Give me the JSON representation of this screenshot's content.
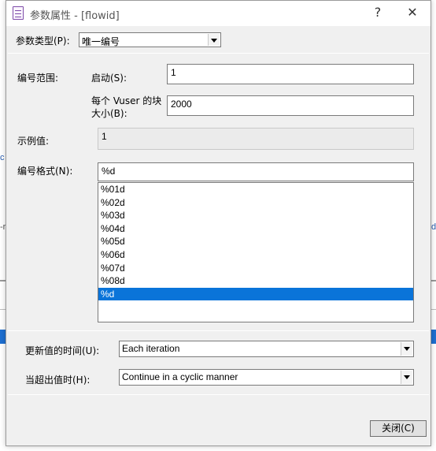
{
  "window": {
    "title": "参数属性 - [flowid]",
    "help_glyph": "?",
    "close_glyph": "✕"
  },
  "background": {
    "frag_left_1": "c",
    "frag_left_2": "-r",
    "frag_right": "d"
  },
  "param_type": {
    "label": "参数类型(P):",
    "value": "唯一编号"
  },
  "range": {
    "label": "编号范围:",
    "start_label": "启动(S):",
    "start_value": "1",
    "block_label_line1": "每个 Vuser 的块",
    "block_label_line2": "大小(B):",
    "block_value": "2000"
  },
  "sample": {
    "label": "示例值:",
    "value": "1"
  },
  "format": {
    "label": "编号格式(N):",
    "value": "%d",
    "options": [
      "%01d",
      "%02d",
      "%03d",
      "%04d",
      "%05d",
      "%06d",
      "%07d",
      "%08d",
      "%d"
    ],
    "selected_index": 8
  },
  "update": {
    "label": "更新值的时间(U):",
    "value": "Each iteration"
  },
  "out_of_values": {
    "label": "当超出值时(H):",
    "value": "Continue in a cyclic manner"
  },
  "close_button": {
    "label": "关闭(C)"
  },
  "colors": {
    "selection": "#0a74d9",
    "dialog_bg": "#f0f0f0"
  }
}
